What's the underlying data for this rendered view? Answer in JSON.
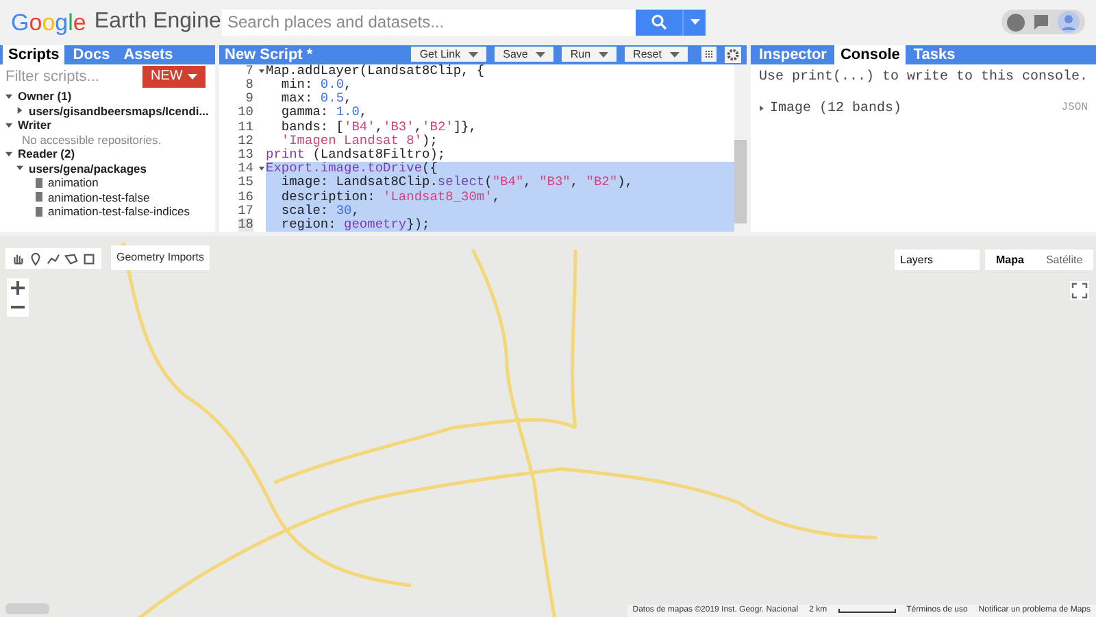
{
  "header": {
    "logo_brand": "Google",
    "logo_product": "Earth Engine",
    "search": {
      "placeholder": "Search places and datasets..."
    }
  },
  "left_panel": {
    "tabs": [
      {
        "label": "Scripts",
        "selected": true
      },
      {
        "label": "Docs",
        "selected": false
      },
      {
        "label": "Assets",
        "selected": false
      }
    ],
    "filter": {
      "placeholder": "Filter scripts..."
    },
    "new_button": "NEW",
    "tree": [
      {
        "label": "Owner (1)",
        "expanded": true,
        "children": [
          {
            "label": "users/gisandbeersmaps/Icendi...",
            "expanded": false
          }
        ]
      },
      {
        "label": "Writer",
        "expanded": true,
        "note": "No accessible repositories."
      },
      {
        "label": "Reader (2)",
        "expanded": true,
        "children": [
          {
            "label": "users/gena/packages",
            "expanded": true,
            "files": [
              "animation",
              "animation-test-false",
              "animation-test-false-indices"
            ]
          }
        ]
      }
    ]
  },
  "editor": {
    "title": "New Script *",
    "buttons": [
      {
        "label": "Get Link"
      },
      {
        "label": "Save"
      },
      {
        "label": "Run"
      },
      {
        "label": "Reset"
      }
    ],
    "lines": [
      {
        "n": "7",
        "foldable": true,
        "selected": false,
        "tokens": [
          {
            "t": "Map.addLayer(Landsat8Clip, {",
            "kind": "plain"
          }
        ]
      },
      {
        "n": "8",
        "foldable": false,
        "selected": false,
        "tokens": [
          {
            "t": "  min: ",
            "kind": "plain"
          },
          {
            "t": "0.0",
            "kind": "number"
          },
          {
            "t": ",",
            "kind": "plain"
          }
        ]
      },
      {
        "n": "9",
        "foldable": false,
        "selected": false,
        "tokens": [
          {
            "t": "  max: ",
            "kind": "plain"
          },
          {
            "t": "0.5",
            "kind": "number"
          },
          {
            "t": ",",
            "kind": "plain"
          }
        ]
      },
      {
        "n": "10",
        "foldable": false,
        "selected": false,
        "tokens": [
          {
            "t": "  gamma: ",
            "kind": "plain"
          },
          {
            "t": "1.0",
            "kind": "number"
          },
          {
            "t": ",",
            "kind": "plain"
          }
        ]
      },
      {
        "n": "11",
        "foldable": false,
        "selected": false,
        "tokens": [
          {
            "t": "  bands: [",
            "kind": "plain"
          },
          {
            "t": "'B4'",
            "kind": "string"
          },
          {
            "t": ",",
            "kind": "plain"
          },
          {
            "t": "'B3'",
            "kind": "string"
          },
          {
            "t": ",",
            "kind": "plain"
          },
          {
            "t": "'B2'",
            "kind": "string"
          },
          {
            "t": "]},",
            "kind": "plain"
          }
        ]
      },
      {
        "n": "12",
        "foldable": false,
        "selected": false,
        "tokens": [
          {
            "t": "  'Imagen Landsat 8'",
            "kind": "string"
          },
          {
            "t": ");",
            "kind": "plain"
          }
        ]
      },
      {
        "n": "13",
        "foldable": false,
        "selected": false,
        "tokens": [
          {
            "t": "print",
            "kind": "keyword"
          },
          {
            "t": " (Landsat8Filtro);",
            "kind": "plain"
          }
        ]
      },
      {
        "n": "14",
        "foldable": true,
        "selected": true,
        "tokens": [
          {
            "t": "Export.image.toDrive",
            "kind": "keyword"
          },
          {
            "t": "({",
            "kind": "plain"
          }
        ]
      },
      {
        "n": "15",
        "foldable": false,
        "selected": true,
        "tokens": [
          {
            "t": "  image: Landsat8Clip.",
            "kind": "plain"
          },
          {
            "t": "select",
            "kind": "keyword"
          },
          {
            "t": "(",
            "kind": "plain"
          },
          {
            "t": "\"B4\"",
            "kind": "string"
          },
          {
            "t": ", ",
            "kind": "plain"
          },
          {
            "t": "\"B3\"",
            "kind": "string"
          },
          {
            "t": ", ",
            "kind": "plain"
          },
          {
            "t": "\"B2\"",
            "kind": "string"
          },
          {
            "t": "),",
            "kind": "plain"
          }
        ]
      },
      {
        "n": "16",
        "foldable": false,
        "selected": true,
        "tokens": [
          {
            "t": "  description: ",
            "kind": "plain"
          },
          {
            "t": "'Landsat8_30m'",
            "kind": "string"
          },
          {
            "t": ",",
            "kind": "plain"
          }
        ]
      },
      {
        "n": "17",
        "foldable": false,
        "selected": true,
        "tokens": [
          {
            "t": "  scale: ",
            "kind": "plain"
          },
          {
            "t": "30",
            "kind": "number"
          },
          {
            "t": ",",
            "kind": "plain"
          }
        ]
      },
      {
        "n": "18",
        "foldable": false,
        "selected": true,
        "tokens": [
          {
            "t": "  region: ",
            "kind": "plain"
          },
          {
            "t": "geometry",
            "kind": "keyword"
          },
          {
            "t": "});",
            "kind": "plain"
          }
        ]
      }
    ]
  },
  "right_panel": {
    "tabs": [
      {
        "label": "Inspector",
        "selected": false
      },
      {
        "label": "Console",
        "selected": true
      },
      {
        "label": "Tasks",
        "selected": false
      }
    ],
    "hint": "Use print(...) to write to this console.",
    "entries": [
      {
        "label": "Image (12 bands)",
        "expanded": false,
        "link": "JSON"
      }
    ]
  },
  "map": {
    "geometry_imports": "Geometry Imports",
    "layers_button": "Layers",
    "map_types": [
      {
        "label": "Mapa",
        "selected": true
      },
      {
        "label": "Satélite",
        "selected": false
      }
    ],
    "attribution": "Datos de mapas ©2019 Inst. Geogr. Nacional",
    "scale": "2 km",
    "terms": "Términos de uso",
    "report": "Notificar un problema de Maps"
  }
}
